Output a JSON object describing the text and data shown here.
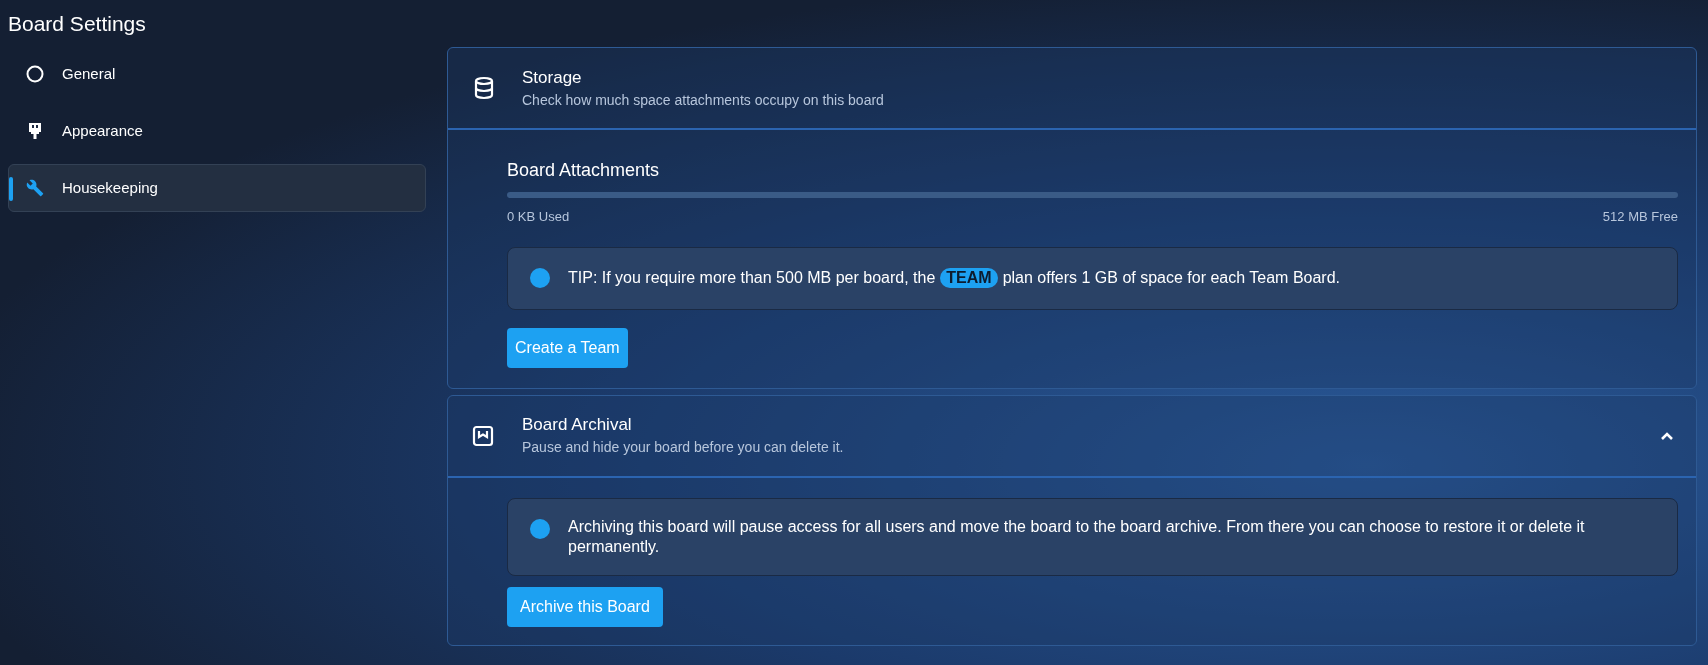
{
  "page_title": "Board Settings",
  "sidebar": {
    "items": [
      {
        "label": "General",
        "selected": false
      },
      {
        "label": "Appearance",
        "selected": false
      },
      {
        "label": "Housekeeping",
        "selected": true
      }
    ]
  },
  "storage": {
    "title": "Storage",
    "subtitle": "Check how much space attachments occupy on this board",
    "attachments_title": "Board Attachments",
    "level": 0,
    "used": "0 KB Used",
    "free": "512 MB Free",
    "tip": {
      "before": "TIP: If you require more than 500 MB per board, the",
      "badge": "TEAM",
      "after": "plan offers 1 GB of space for each Team Board."
    },
    "button": "Create a Team"
  },
  "archival": {
    "title": "Board Archival",
    "subtitle": "Pause and hide your board before you can delete it.",
    "expanded": true,
    "notice": "Archiving this board will pause access for all users and move the board to the board archive. From there you can choose to restore it or delete it permanently.",
    "button": "Archive this Board"
  }
}
